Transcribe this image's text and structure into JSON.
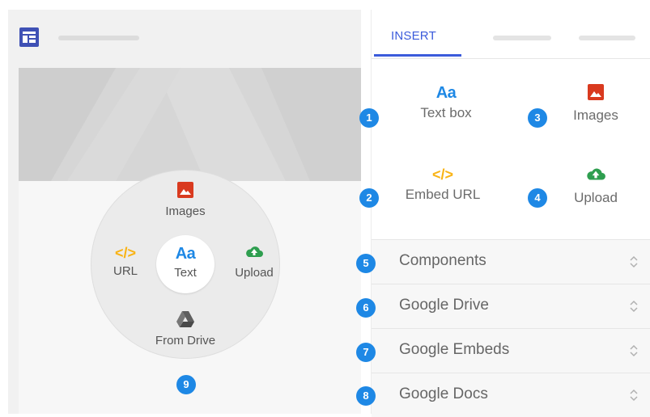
{
  "canvas": {
    "radial_menu": {
      "center": {
        "glyph": "Aa",
        "label": "Text"
      },
      "top": {
        "icon": "image-icon",
        "label": "Images"
      },
      "left": {
        "glyph": "</>",
        "label": "URL"
      },
      "right": {
        "icon": "cloud-upload-icon",
        "label": "Upload"
      },
      "bottom": {
        "icon": "google-drive-icon",
        "label": "From Drive"
      },
      "badge": "9"
    }
  },
  "sidebar": {
    "tab_insert": "INSERT",
    "insert_items": [
      {
        "badge": "1",
        "glyph": "Aa",
        "label": "Text box"
      },
      {
        "badge": "2",
        "glyph": "</>",
        "label": "Embed URL"
      },
      {
        "badge": "3",
        "icon": "image-icon",
        "label": "Images"
      },
      {
        "badge": "4",
        "icon": "cloud-upload-icon",
        "label": "Upload"
      }
    ],
    "sections": [
      {
        "badge": "5",
        "label": "Components"
      },
      {
        "badge": "6",
        "label": "Google Drive"
      },
      {
        "badge": "7",
        "label": "Google Embeds"
      },
      {
        "badge": "8",
        "label": "Google Docs"
      }
    ]
  },
  "colors": {
    "accent_blue": "#1e88e5",
    "tab_blue": "#3b5bdb",
    "image_red": "#d93a1f",
    "code_yellow": "#f9b314",
    "upload_green": "#2e9e4f"
  }
}
